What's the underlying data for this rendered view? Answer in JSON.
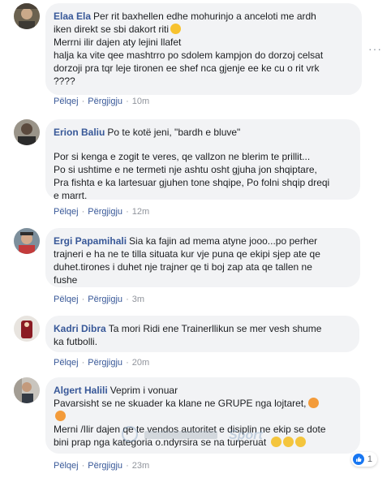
{
  "comments": [
    {
      "author": "Elaa Ela",
      "lines": [
        "Per rit baxhellen edhe mohurinjo a anceloti me ardh",
        "iken direkt se sbi dakort riti",
        "Merrni ilir dajen aty lejini llafet",
        "halja ka vite qee mashtrro po sdolem kampjon do dorzoj celsat",
        "dorzoji pra tqr leje tironen ee shef nca gjenje ee ke cu o rit vrk",
        "????"
      ],
      "reply": "Pëlqej",
      "reply2": "Përgjigju",
      "time": "10m"
    },
    {
      "author": "Erion Baliu",
      "first_line": "Po te kotë jeni, \"bardh e bluve\"",
      "lines": [
        "Por si kenga e zogit te veres, qe vallzon ne blerim te prillit...",
        "Po si ushtime e ne termeti nje ashtu osht gjuha jon shqiptare,",
        "Pra fishta e ka lartesuar gjuhen tone shqipe, Po folni shqip dreqi",
        "e marrt."
      ],
      "reply": "Pëlqej",
      "reply2": "Përgjigju",
      "time": "12m"
    },
    {
      "author": "Ergi Papamihali",
      "lines": [
        "Sia ka fajin ad mema atyne jooo...po perher",
        "trajneri e ha ne te tilla situata kur vje puna qe ekipi sjep ate qe",
        "duhet.tirones i duhet nje trajner qe ti boj zap ata qe tallen ne",
        "fushe"
      ],
      "reply": "Pëlqej",
      "reply2": "Përgjigju",
      "time": "3m"
    },
    {
      "author": "Kadri Dibra",
      "lines": [
        "Ta mori Ridi ene Trainerllikun se mer vesh shume",
        "ka futbolli."
      ],
      "reply": "Pëlqej",
      "reply2": "Përgjigju",
      "time": "20m"
    },
    {
      "author": "Algert Halili",
      "lines": [
        "Veprim i vonuar",
        "Pavarsisht se ne skuader ka klane ne GRUPE nga lojtaret,",
        "",
        "Merni /Ilir dajen qe te vendos autoritet e disiplin ne ekip se dote",
        "bini prap nga kategoria o.ndyrsira se na turperuat"
      ],
      "reply": "Pëlqej",
      "reply2": "Përgjigju",
      "time": "23m",
      "likes": "1"
    }
  ],
  "more_glyph": "···",
  "colors": {
    "author": "#385898",
    "bubble": "#f2f3f5",
    "meta": "#90949c",
    "like": "#1877f2"
  },
  "watermark_text": "Sport"
}
